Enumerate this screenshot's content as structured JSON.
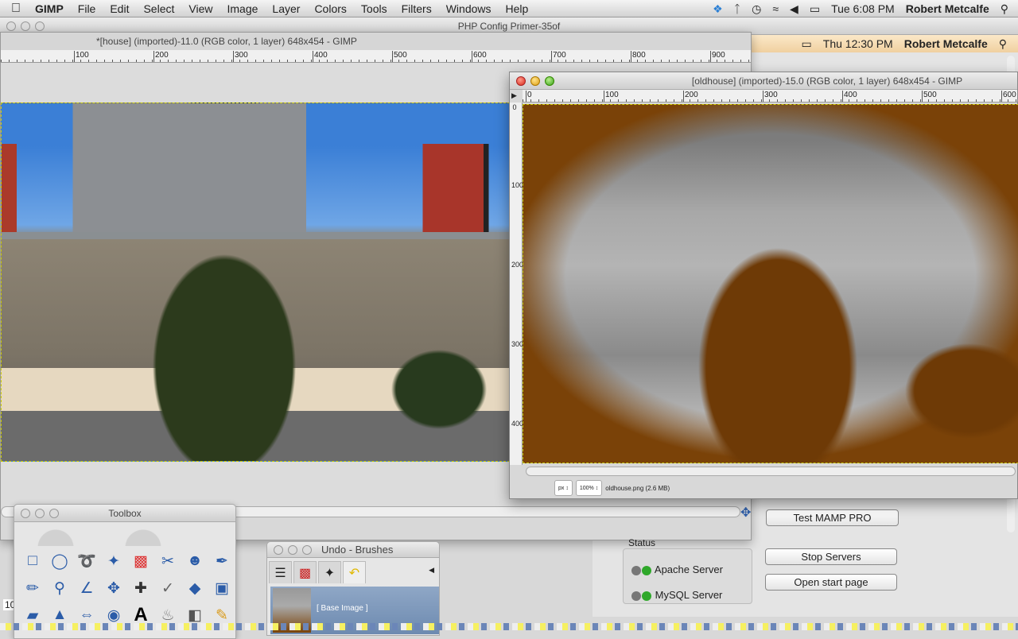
{
  "menubar": {
    "app": "GIMP",
    "items": [
      "File",
      "Edit",
      "Select",
      "View",
      "Image",
      "Layer",
      "Colors",
      "Tools",
      "Filters",
      "Windows",
      "Help"
    ],
    "clock": "Tue 6:08 PM",
    "user": "Robert Metcalfe"
  },
  "back_window": {
    "title": "PHP Config Primer-35of"
  },
  "mamp": {
    "clock": "Thu 12:30 PM",
    "user": "Robert Metcalfe",
    "test_button": "Test MAMP PRO",
    "status_label": "Status",
    "apache": "Apache Server",
    "mysql": "MySQL Server",
    "stop_button": "Stop Servers",
    "start_page_button": "Open start page"
  },
  "house_window": {
    "title": "*[house] (imported)-11.0 (RGB color, 1 layer) 648x454 - GIMP",
    "ruler": [
      "100",
      "200",
      "300",
      "400",
      "500",
      "600",
      "700",
      "800",
      "900"
    ],
    "zoom_fragment": "10"
  },
  "old_window": {
    "title": "[oldhouse] (imported)-15.0 (RGB color, 1 layer) 648x454 - GIMP",
    "ruler": [
      "0",
      "100",
      "200",
      "300",
      "400",
      "500",
      "600"
    ],
    "vruler": [
      "0",
      "100",
      "200",
      "300",
      "400"
    ],
    "unit": "px",
    "zoom": "100%",
    "file_info": "oldhouse.png (2.6 MB)"
  },
  "toolbox": {
    "title": "Toolbox",
    "tools": [
      "rect-select",
      "ellipse-select",
      "free-select",
      "fuzzy-select",
      "select-by-color",
      "scissors",
      "foreground-select",
      "paths",
      "color-picker",
      "zoom",
      "measure",
      "move",
      "align",
      "crop",
      "rotate",
      "scale",
      "shear",
      "perspective",
      "flip",
      "cage-transform",
      "text",
      "bucket-fill",
      "blend",
      "pencil"
    ]
  },
  "undo": {
    "title": "Undo - Brushes",
    "item": "[ Base Image ]"
  },
  "colors": {
    "accent_select": "#6d8ab0",
    "led_green": "#2fa82a",
    "led_gray": "#777777"
  }
}
